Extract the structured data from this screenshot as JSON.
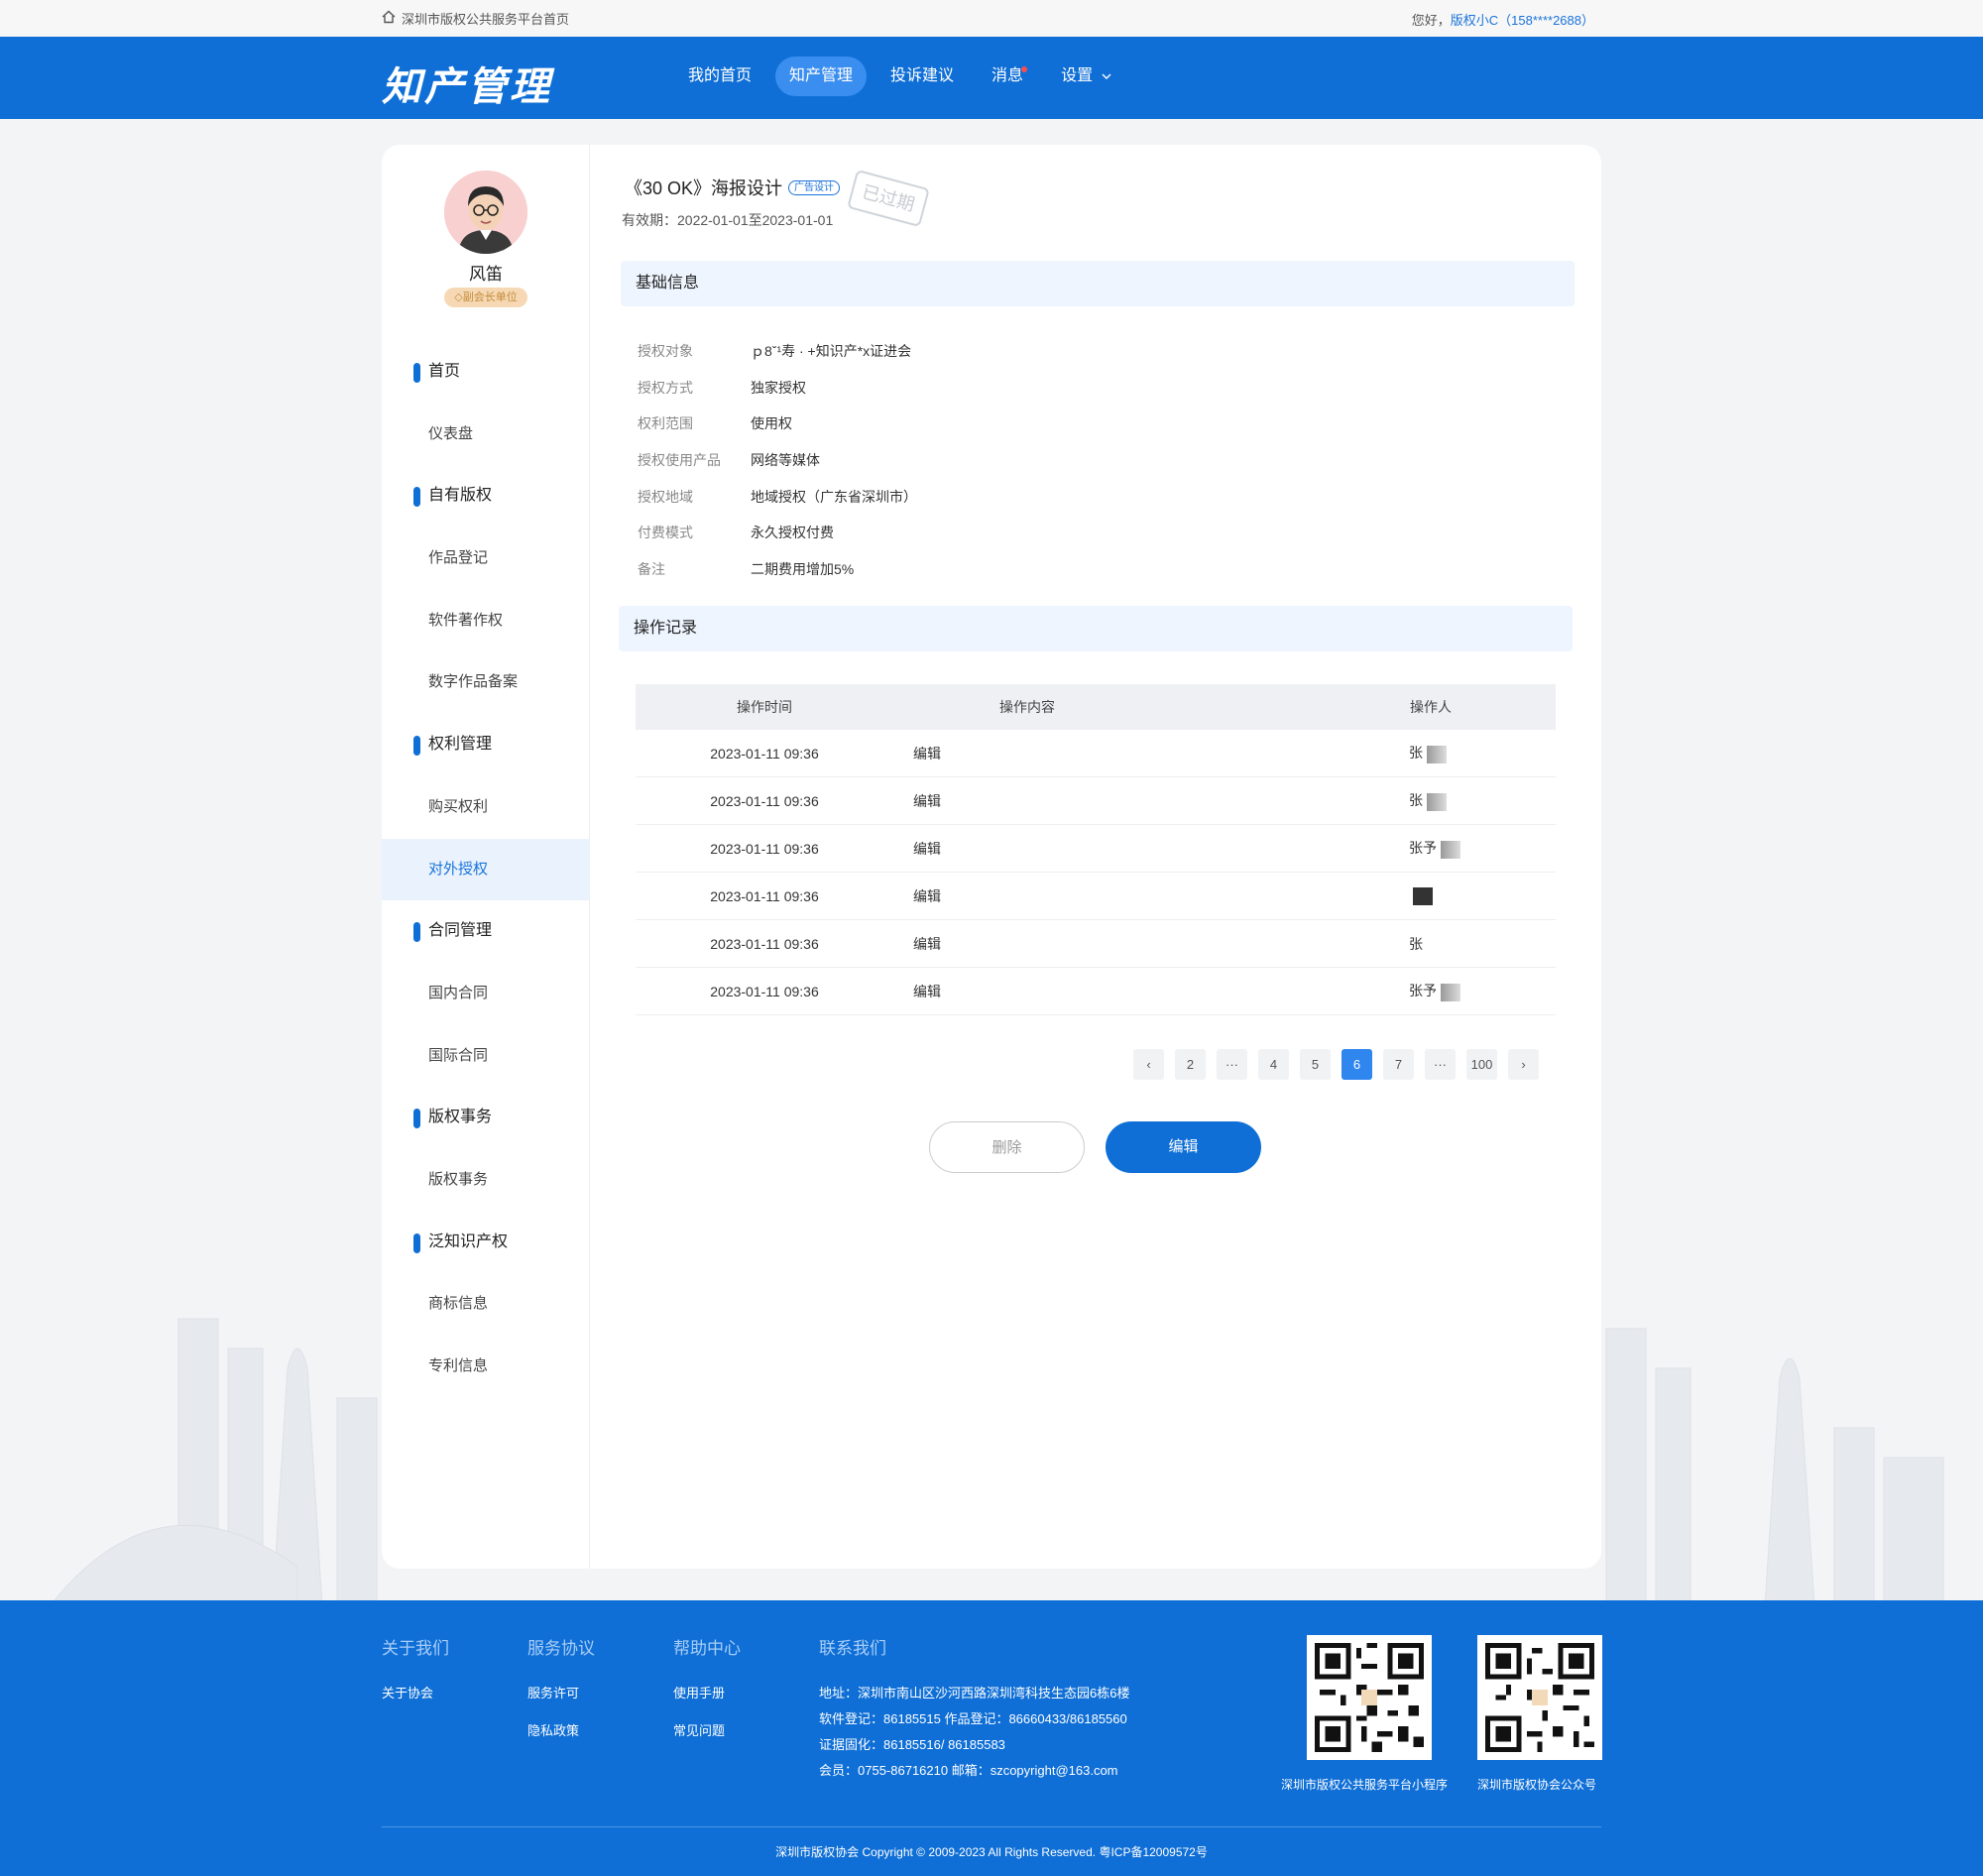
{
  "topbar": {
    "home_link": "深圳市版权公共服务平台首页",
    "greeting": "您好，",
    "user": "版权小C（158****2688）"
  },
  "header": {
    "logo": "知产管理",
    "nav": [
      {
        "label": "我的首页",
        "active": false
      },
      {
        "label": "知产管理",
        "active": true
      },
      {
        "label": "投诉建议",
        "active": false
      },
      {
        "label": "消息",
        "active": false,
        "dot": true
      },
      {
        "label": "设置",
        "active": false,
        "chevron": true
      }
    ]
  },
  "profile": {
    "name": "风笛",
    "badge": "副会长单位"
  },
  "sidebar": {
    "items": [
      {
        "label": "首页",
        "group": true
      },
      {
        "label": "仪表盘"
      },
      {
        "label": "自有版权",
        "group": true
      },
      {
        "label": "作品登记"
      },
      {
        "label": "软件著作权"
      },
      {
        "label": "数字作品备案"
      },
      {
        "label": "权利管理",
        "group": true
      },
      {
        "label": "购买权利"
      },
      {
        "label": "对外授权",
        "active": true
      },
      {
        "label": "合同管理",
        "group": true
      },
      {
        "label": "国内合同"
      },
      {
        "label": "国际合同"
      },
      {
        "label": "版权事务",
        "group": true
      },
      {
        "label": "版权事务"
      },
      {
        "label": "泛知识产权",
        "group": true
      },
      {
        "label": "商标信息"
      },
      {
        "label": "专利信息"
      }
    ]
  },
  "detail": {
    "title": "《30 OK》海报设计",
    "tag": "广告设计",
    "stamp": "已过期",
    "validity": "有效期：2022-01-01至2023-01-01"
  },
  "basic_info": {
    "heading": "基础信息",
    "rows": [
      {
        "k": "授权对象",
        "v": "ｐ8ˇ¹寿 · +知识产*x证进会"
      },
      {
        "k": "授权方式",
        "v": "独家授权"
      },
      {
        "k": "权利范围",
        "v": "使用权"
      },
      {
        "k": "授权使用产品",
        "v": "网络等媒体"
      },
      {
        "k": "授权地域",
        "v": "地域授权（广东省深圳市）"
      },
      {
        "k": "付费模式",
        "v": "永久授权付费"
      },
      {
        "k": "备注",
        "v": "二期费用增加5%"
      }
    ]
  },
  "records": {
    "heading": "操作记录",
    "columns": [
      "操作时间",
      "操作内容",
      "操作人"
    ],
    "rows": [
      {
        "time": "2023-01-11 09:36",
        "content": "编辑",
        "operator": "张"
      },
      {
        "time": "2023-01-11 09:36",
        "content": "编辑",
        "operator": "张"
      },
      {
        "time": "2023-01-11 09:36",
        "content": "编辑",
        "operator": "张予"
      },
      {
        "time": "2023-01-11 09:36",
        "content": "编辑",
        "operator": ""
      },
      {
        "time": "2023-01-11 09:36",
        "content": "编辑",
        "operator": "张"
      },
      {
        "time": "2023-01-11 09:36",
        "content": "编辑",
        "operator": "张予"
      }
    ]
  },
  "pagination": {
    "pages": [
      "‹",
      "2",
      "···",
      "4",
      "5",
      "6",
      "7",
      "···",
      "100",
      "›"
    ],
    "current": "6"
  },
  "actions": {
    "delete": "删除",
    "edit": "编辑"
  },
  "footer": {
    "about": {
      "title": "关于我们",
      "links": [
        "关于协会"
      ]
    },
    "service": {
      "title": "服务协议",
      "links": [
        "服务许可",
        "隐私政策"
      ]
    },
    "help": {
      "title": "帮助中心",
      "links": [
        "使用手册",
        "常见问题"
      ]
    },
    "contact": {
      "title": "联系我们",
      "lines": [
        "地址：深圳市南山区沙河西路深圳湾科技生态园6栋6楼",
        "软件登记：86185515  作品登记：86660433/86185560",
        "证据固化：86185516/ 86185583",
        "会员：0755-86716210  邮箱：szcopyright@163.com"
      ]
    },
    "qr1_label": "深圳市版权公共服务平台小程序",
    "qr2_label": "深圳市版权协会公众号",
    "copyright": "深圳市版权协会 Copyright © 2009-2023 All Rights Reserved.     粤ICP备12009572号"
  },
  "colors": {
    "brand": "#0f6fd6",
    "accent": "#2f86ee",
    "bg": "#f3f4f6"
  }
}
